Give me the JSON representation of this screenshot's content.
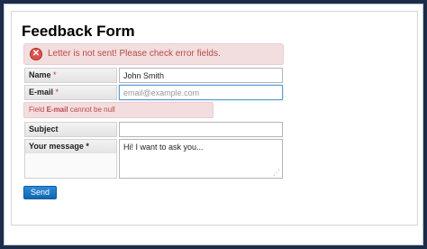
{
  "form": {
    "title": "Feedback Form",
    "alert_message": "Letter is not sent! Please check error fields.",
    "alert_icon": "error-x-icon",
    "fields": {
      "name_label": "Name",
      "name_value": "John Smith",
      "email_label": "E-mail",
      "email_placeholder": "email@example.com",
      "subject_label": "Subject",
      "subject_value": "",
      "message_label": "Your message",
      "message_value": "Hi! I want to ask you..."
    },
    "required_mark": "*",
    "email_error": {
      "prefix": "Field ",
      "field": "E-mail",
      "suffix": " cannot be null"
    },
    "send_label": "Send"
  },
  "colors": {
    "error_bg": "#f2dede",
    "error_text": "#b94a48",
    "button": "#1a73c2",
    "background": "#1c2d4a"
  }
}
